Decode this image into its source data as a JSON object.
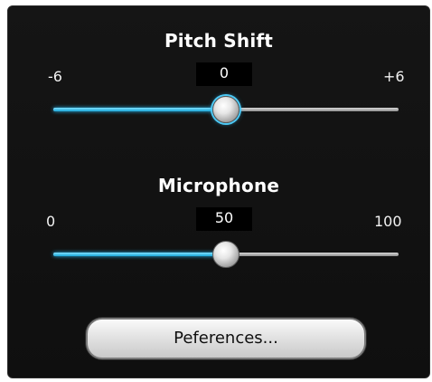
{
  "pitch_shift": {
    "title": "Pitch Shift",
    "min_label": "-6",
    "max_label": "+6",
    "value_label": "0",
    "min": -6,
    "max": 6,
    "value": 0
  },
  "microphone": {
    "title": "Microphone",
    "min_label": "0",
    "max_label": "100",
    "value_label": "50",
    "min": 0,
    "max": 100,
    "value": 50
  },
  "preferences_button": {
    "label": "Peferences..."
  },
  "colors": {
    "panel_background": "#121212",
    "slider_fill": "#1ba6d8",
    "slider_track": "#bdbdbd"
  }
}
